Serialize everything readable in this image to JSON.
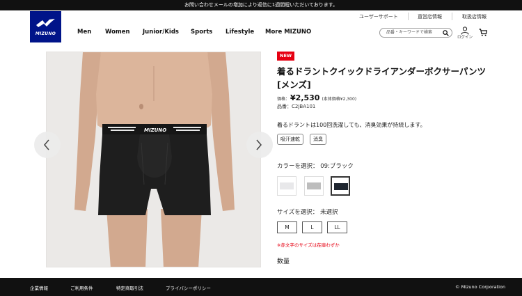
{
  "announcement": "お問い合わせメールの増加により返信に1週間程いただいております。",
  "utility_links": [
    "ユーザーサポート",
    "直営店情報",
    "取扱店情報"
  ],
  "logo": {
    "text": "MIZUNO",
    "color": "#001489"
  },
  "nav": [
    "Men",
    "Women",
    "Junior/Kids",
    "Sports",
    "Lifestyle",
    "More MIZUNO"
  ],
  "search": {
    "placeholder": "品番・キーワードで検索",
    "icon": "search-icon"
  },
  "header_icons": {
    "login_label": "ログイン",
    "user": "user-icon",
    "cart": "cart-icon"
  },
  "product": {
    "badge": "NEW",
    "title": "着るドラントクイックドライアンダーボクサーパンツ[メンズ]",
    "price_label": "価格：",
    "price": "¥2,530",
    "price_tax_note": "(本体価格¥2,300)",
    "code_label": "品番：",
    "code": "C2JBA101",
    "description": "着るドラントは100回洗濯しても、消臭効果が持続します。",
    "tags": [
      "吸汗速乾",
      "消臭"
    ],
    "color_label": "カラーを選択：",
    "color_selected": "09:ブラック",
    "colors": [
      {
        "name": "white",
        "hex": "#e8e8ea"
      },
      {
        "name": "gray",
        "hex": "#bdbdbd"
      },
      {
        "name": "black",
        "hex": "#1f2630"
      }
    ],
    "size_label": "サイズを選択：",
    "size_selected": "未選択",
    "sizes": [
      "M",
      "L",
      "LL"
    ],
    "stock_note": "※赤文字のサイズは在庫わずか",
    "quantity_label": "数量"
  },
  "footer": {
    "links": [
      "企業情報",
      "ご利用条件",
      "特定商取引法",
      "プライバシーポリシー"
    ],
    "copyright": "© Mizuno Corporation"
  }
}
